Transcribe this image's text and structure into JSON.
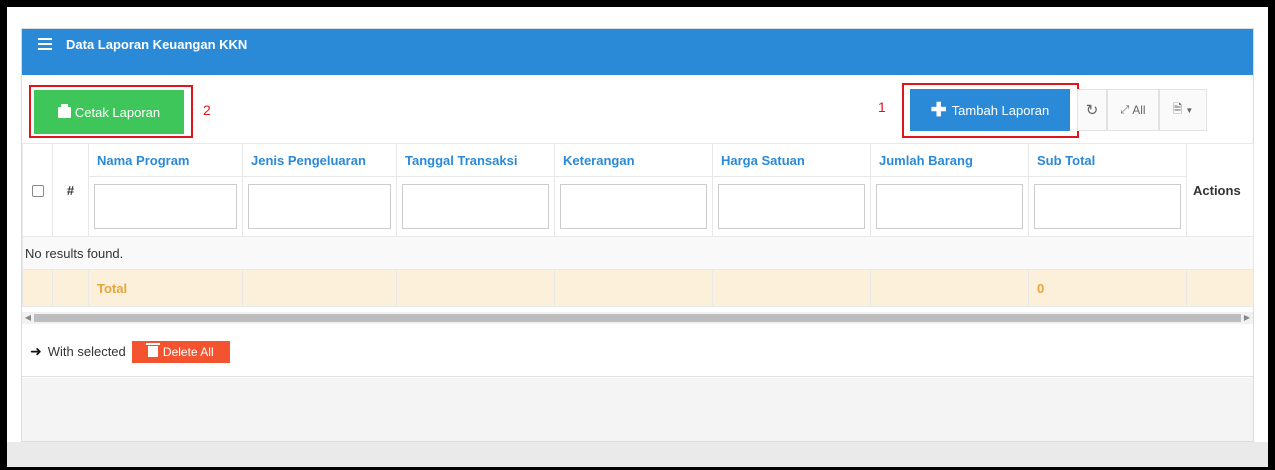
{
  "panel": {
    "title": "Data Laporan Keuangan KKN",
    "title_icon": "list-icon"
  },
  "toolbar": {
    "print_label": "Cetak Laporan",
    "print_icon": "print-icon",
    "add_label": "Tambah Laporan",
    "add_icon": "plus-icon",
    "refresh_icon": "refresh-icon",
    "all_label": "All",
    "export_icon": "export-icon",
    "annotation_1": "1",
    "annotation_2": "2"
  },
  "table": {
    "hash": "#",
    "columns": [
      "Nama Program",
      "Jenis Pengeluaran",
      "Tanggal Transaksi",
      "Keterangan",
      "Harga Satuan",
      "Jumlah Barang",
      "Sub Total"
    ],
    "actions": "Actions",
    "empty_text": "No results found.",
    "total_label": "Total",
    "total_value": "0"
  },
  "bulk": {
    "with_selected": "With selected",
    "delete_label": "Delete All"
  },
  "colors": {
    "primary": "#2a8ad8",
    "success": "#3ec65a",
    "danger": "#f3542f",
    "annotation": "#e0141b",
    "total_row": "#fcf0da"
  }
}
